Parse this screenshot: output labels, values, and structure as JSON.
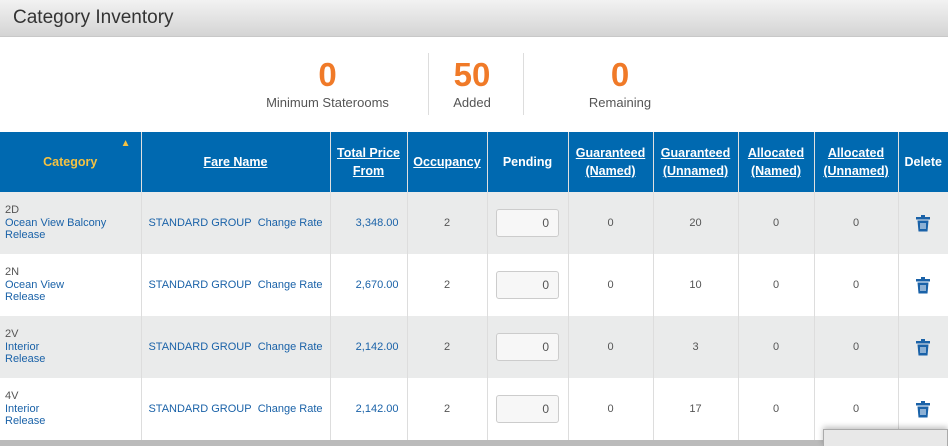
{
  "title": "Category Inventory",
  "stats": [
    {
      "value": "0",
      "label": "Minimum Staterooms"
    },
    {
      "value": "50",
      "label": "Added"
    },
    {
      "value": "0",
      "label": "Remaining"
    }
  ],
  "headers": {
    "category": "Category",
    "fare": "Fare Name",
    "price_1": "Total Price",
    "price_2": "From",
    "occupancy": "Occupancy",
    "pending": "Pending",
    "gn_1": "Guaranteed",
    "gn_2": "(Named)",
    "gu_1": "Guaranteed",
    "gu_2": "(Unnamed)",
    "an_1": "Allocated",
    "an_2": "(Named)",
    "au_1": "Allocated",
    "au_2": "(Unnamed)",
    "delete": "Delete"
  },
  "sort_indicator": "▲",
  "rows": [
    {
      "code": "2D",
      "name": "Ocean View Balcony",
      "type": "Release",
      "fare": "STANDARD GROUP",
      "change": "Change Rate",
      "price": "3,348.00",
      "occupancy": "2",
      "pending": "0",
      "gn": "0",
      "gu": "20",
      "an": "0",
      "au": "0"
    },
    {
      "code": "2N",
      "name": "Ocean View",
      "type": "Release",
      "fare": "STANDARD GROUP",
      "change": "Change Rate",
      "price": "2,670.00",
      "occupancy": "2",
      "pending": "0",
      "gn": "0",
      "gu": "10",
      "an": "0",
      "au": "0"
    },
    {
      "code": "2V",
      "name": "Interior",
      "type": "Release",
      "fare": "STANDARD GROUP",
      "change": "Change Rate",
      "price": "2,142.00",
      "occupancy": "2",
      "pending": "0",
      "gn": "0",
      "gu": "3",
      "an": "0",
      "au": "0"
    },
    {
      "code": "4V",
      "name": "Interior",
      "type": "Release",
      "fare": "STANDARD GROUP",
      "change": "Change Rate",
      "price": "2,142.00",
      "occupancy": "2",
      "pending": "0",
      "gn": "0",
      "gu": "17",
      "an": "0",
      "au": "0"
    }
  ],
  "colors": {
    "header_bg": "#0069b0",
    "accent": "#f07a28",
    "sort_active": "#f5c242"
  }
}
